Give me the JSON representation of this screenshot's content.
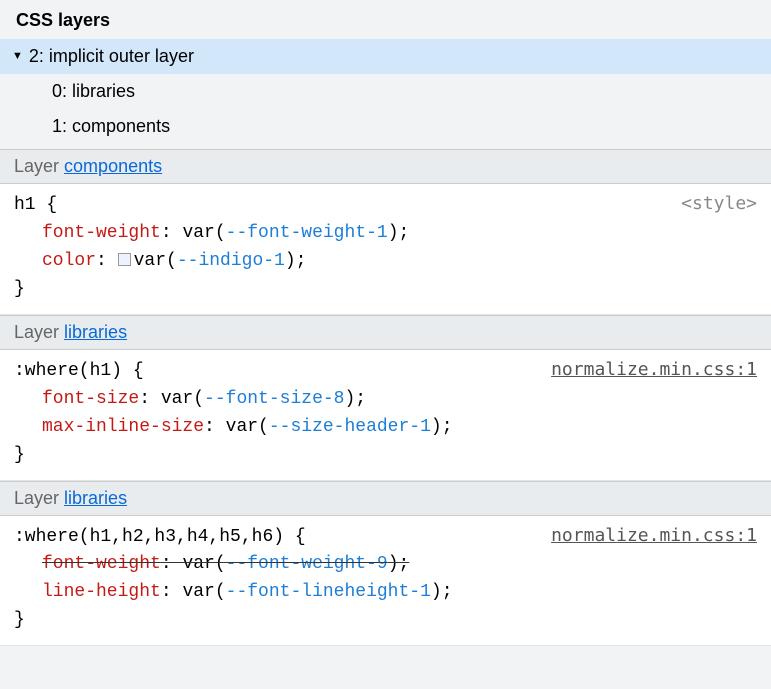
{
  "header": {
    "title": "CSS layers"
  },
  "tree": {
    "root": {
      "label": "2: implicit outer layer",
      "expanded": true
    },
    "children": [
      {
        "label": "0: libraries"
      },
      {
        "label": "1: components"
      }
    ]
  },
  "layer_label": "Layer",
  "sections": [
    {
      "layer_link": "components",
      "selector": "h1",
      "open_brace": "{",
      "close_brace": "}",
      "source": "<style>",
      "source_kind": "tag",
      "decls": [
        {
          "prop": "font-weight",
          "func": "var(",
          "varname": "--font-weight-1",
          "close": ");",
          "swatch": false,
          "struck": false
        },
        {
          "prop": "color",
          "func": "var(",
          "varname": "--indigo-1",
          "close": ");",
          "swatch": true,
          "struck": false
        }
      ]
    },
    {
      "layer_link": "libraries",
      "selector": ":where(h1)",
      "open_brace": "{",
      "close_brace": "}",
      "source": "normalize.min.css:1",
      "source_kind": "link",
      "decls": [
        {
          "prop": "font-size",
          "func": "var(",
          "varname": "--font-size-8",
          "close": ");",
          "swatch": false,
          "struck": false
        },
        {
          "prop": "max-inline-size",
          "func": "var(",
          "varname": "--size-header-1",
          "close": ");",
          "swatch": false,
          "struck": false
        }
      ]
    },
    {
      "layer_link": "libraries",
      "selector": ":where(h1,h2,h3,h4,h5,h6)",
      "open_brace": "{",
      "close_brace": "}",
      "source": "normalize.min.css:1",
      "source_kind": "link",
      "decls": [
        {
          "prop": "font-weight",
          "func": "var(",
          "varname": "--font-weight-9",
          "close": ");",
          "swatch": false,
          "struck": true
        },
        {
          "prop": "line-height",
          "func": "var(",
          "varname": "--font-lineheight-1",
          "close": ");",
          "swatch": false,
          "struck": false
        }
      ]
    }
  ]
}
